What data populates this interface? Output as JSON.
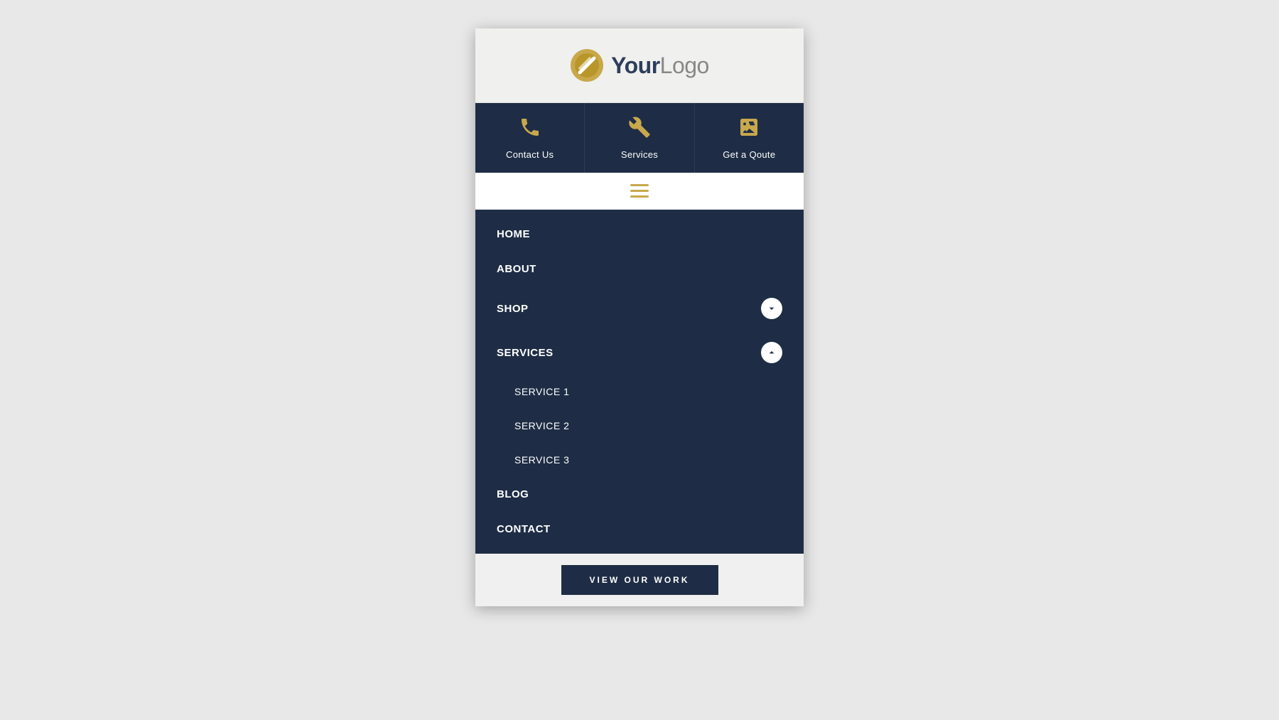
{
  "header": {
    "logo_your": "Your",
    "logo_logo": "Logo"
  },
  "top_nav": {
    "items": [
      {
        "id": "contact",
        "label": "Contact Us",
        "icon": "phone"
      },
      {
        "id": "services",
        "label": "Services",
        "icon": "wrench"
      },
      {
        "id": "quote",
        "label": "Get a Qoute",
        "icon": "calculator"
      }
    ]
  },
  "mobile_menu": {
    "items": [
      {
        "id": "home",
        "label": "HOME",
        "has_dropdown": false,
        "expanded": false
      },
      {
        "id": "about",
        "label": "ABOUT",
        "has_dropdown": false,
        "expanded": false
      },
      {
        "id": "shop",
        "label": "SHOP",
        "has_dropdown": true,
        "expanded": false
      },
      {
        "id": "services",
        "label": "SERVICES",
        "has_dropdown": true,
        "expanded": true
      },
      {
        "id": "service1",
        "label": "SERVICE 1",
        "sub": true
      },
      {
        "id": "service2",
        "label": "SERVICE 2",
        "sub": true
      },
      {
        "id": "service3",
        "label": "SERVICE 3",
        "sub": true
      },
      {
        "id": "blog",
        "label": "BLOG",
        "has_dropdown": false,
        "expanded": false
      },
      {
        "id": "contact",
        "label": "CONTACT",
        "has_dropdown": false,
        "expanded": false
      }
    ]
  },
  "cta": {
    "label": "VIEW OUR WORK"
  },
  "colors": {
    "primary_dark": "#1e2d45",
    "gold": "#c8a84b",
    "white": "#ffffff",
    "bg_light": "#f0f0ee"
  }
}
